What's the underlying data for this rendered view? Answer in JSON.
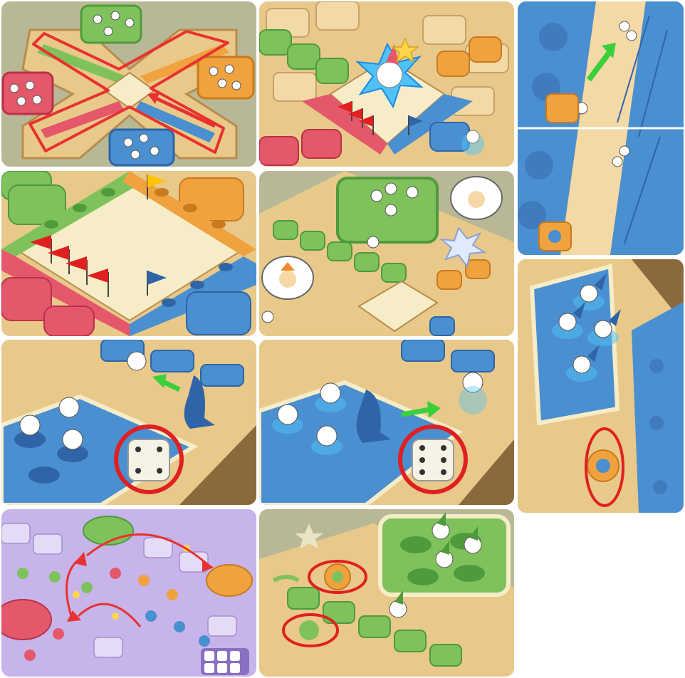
{
  "page": {
    "title": "",
    "background": "#ffffff"
  },
  "colors": {
    "cream_tile": "#f2d9a6",
    "cream_tile_dark": "#d9b57a",
    "green": "#7fc25b",
    "green_dark": "#4e9a3c",
    "red": "#e5576b",
    "red_dark": "#b83248",
    "blue": "#4a8fd0",
    "blue_dark": "#2f65a6",
    "orange": "#f0a23e",
    "orange_dark": "#c97a1e",
    "path_arrow": "#e8322f",
    "move_arrow": "#3ccf3c",
    "highlight_ring": "#e02020",
    "ground": "#b9b896",
    "purple_board": "#c7b4ea"
  },
  "panels": [
    {
      "name": "board-overview-route",
      "icons": [
        "route-loop-arrow-icon",
        "direction-arrow-icon"
      ]
    },
    {
      "name": "capture-impact",
      "icons": [
        "star-icon",
        "impact-burst-icon",
        "red-flag-icon",
        "blue-flag-icon"
      ]
    },
    {
      "name": "shortcut-climb",
      "icons": [
        "up-arrow-icon"
      ]
    },
    {
      "name": "center-home-flags",
      "icons": [
        "red-flag-icon",
        "yellow-flag-icon",
        "blue-flag-icon"
      ]
    },
    {
      "name": "bump-to-base",
      "icons": [
        "speech-bubble-icon",
        "impact-burst-icon"
      ]
    },
    {
      "name": "blue-base-pieces",
      "icons": [
        "orange-flower-tile-icon",
        "highlight-ring-icon"
      ]
    },
    {
      "name": "dice-four-leave-base",
      "icons": [
        "dice-icon",
        "left-arrow-icon"
      ],
      "dice_value": 4
    },
    {
      "name": "dice-six-leave-base",
      "icons": [
        "dice-icon",
        "right-arrow-icon"
      ],
      "dice_value": 6
    },
    {
      "name": "jump-arcs-purple-board",
      "icons": [
        "jump-arc-icon",
        "dice-set-icon"
      ]
    },
    {
      "name": "green-start-flower-tiles",
      "icons": [
        "flower-tile-icon",
        "highlight-ring-icon"
      ]
    }
  ]
}
